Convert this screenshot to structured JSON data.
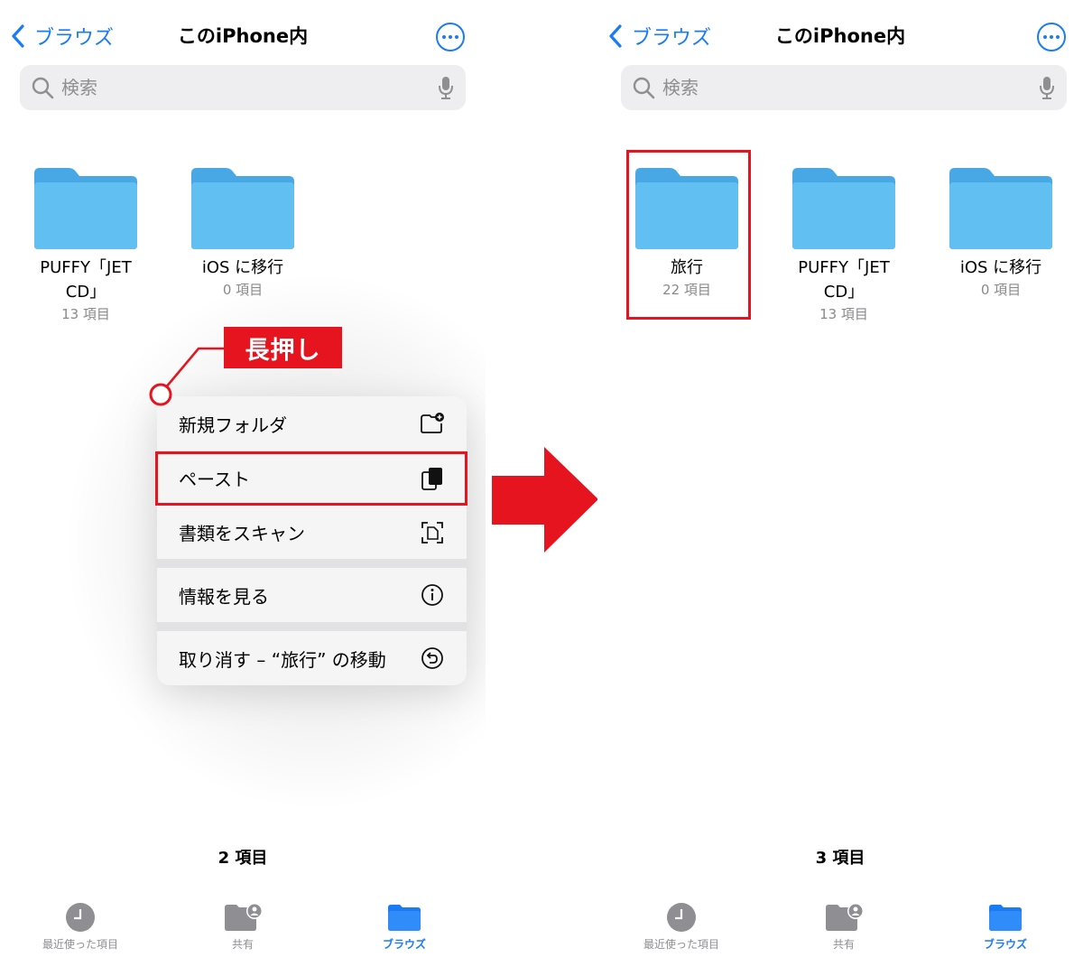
{
  "nav": {
    "back_label": "ブラウズ",
    "title": "このiPhone内"
  },
  "search": {
    "placeholder": "検索"
  },
  "left": {
    "folders": [
      {
        "name": "PUFFY「JET CD」",
        "count": "13 項目"
      },
      {
        "name": "iOS に移行",
        "count": "0 項目"
      }
    ],
    "item_count": "2 項目"
  },
  "right": {
    "folders": [
      {
        "name": "旅行",
        "count": "22 項目"
      },
      {
        "name": "PUFFY「JET CD」",
        "count": "13 項目"
      },
      {
        "name": "iOS に移行",
        "count": "0 項目"
      }
    ],
    "item_count": "3 項目"
  },
  "context_menu": {
    "items": [
      {
        "label": "新規フォルダ",
        "icon": "new-folder-icon"
      },
      {
        "label": "ペースト",
        "icon": "paste-icon"
      },
      {
        "label": "書類をスキャン",
        "icon": "scan-document-icon"
      },
      {
        "label": "情報を見る",
        "icon": "info-icon"
      },
      {
        "label": "取り消す – “旅行” の移動",
        "icon": "undo-icon"
      }
    ]
  },
  "annotation": {
    "long_press": "長押し"
  },
  "tabs": [
    {
      "label": "最近使った項目",
      "icon": "clock-icon"
    },
    {
      "label": "共有",
      "icon": "shared-folder-icon"
    },
    {
      "label": "ブラウズ",
      "icon": "folder-icon"
    }
  ],
  "colors": {
    "accent": "#1a7cf5",
    "folder": "#5ab8f0",
    "highlight": "#e5141f"
  }
}
